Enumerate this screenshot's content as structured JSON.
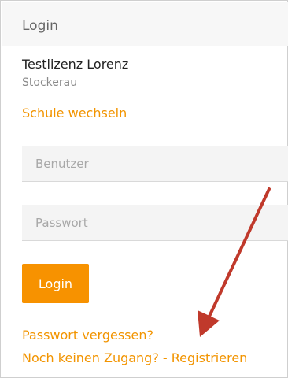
{
  "header": {
    "title": "Login"
  },
  "license": {
    "name": "Testlizenz Lorenz",
    "city": "Stockerau"
  },
  "switch_school_label": "Schule wechseln",
  "form": {
    "username_placeholder": "Benutzer",
    "password_placeholder": "Passwort",
    "username_value": "",
    "password_value": ""
  },
  "login_button_label": "Login",
  "links": {
    "forgot_password": "Passwort vergessen?",
    "register": "Noch keinen Zugang? - Registrieren"
  },
  "colors": {
    "accent": "#f29400",
    "button": "#f79200",
    "annotation_arrow": "#c0392b"
  },
  "icons": {
    "annotation": "arrow-annotation-icon"
  }
}
